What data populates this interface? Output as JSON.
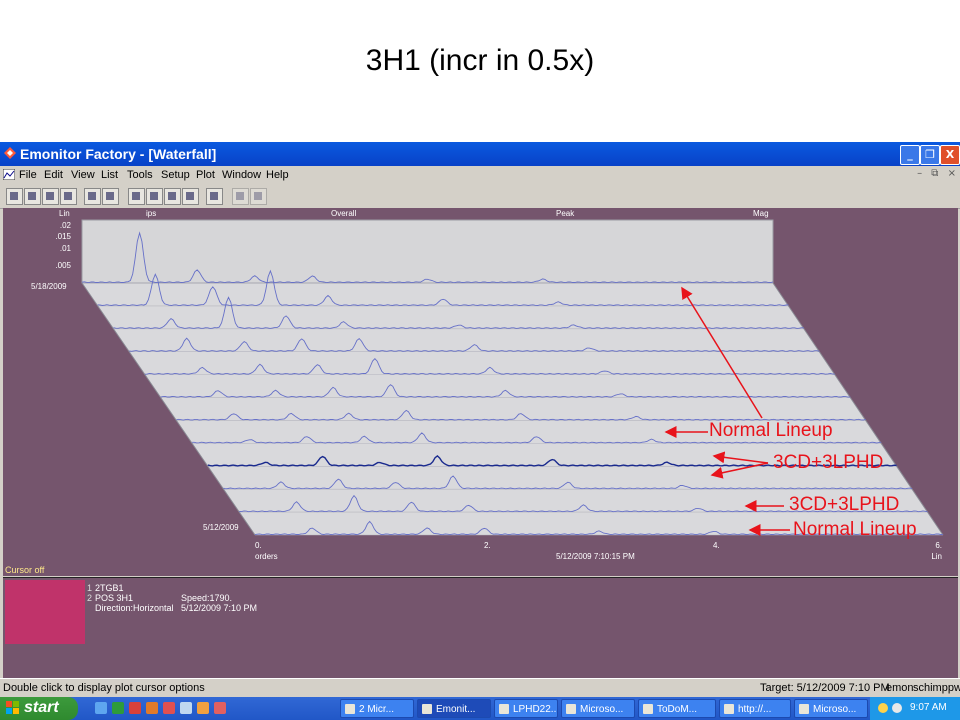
{
  "slide": {
    "title": "3H1 (incr in 0.5x)"
  },
  "window": {
    "title": "Emonitor Factory - [Waterfall]",
    "buttons": {
      "minimize": "_",
      "restore": "❐",
      "close": "X"
    },
    "mdi_buttons": [
      "–",
      "⧉",
      "×"
    ]
  },
  "menu": [
    "File",
    "Edit",
    "View",
    "List",
    "Tools",
    "Setup",
    "Plot",
    "Window",
    "Help"
  ],
  "plot": {
    "header": {
      "units": "Lin",
      "amplitude_unit": "ips",
      "overall": "Overall",
      "peak": "Peak",
      "mag": "Mag"
    },
    "y_ticks": [
      ".02",
      ".015",
      ".01",
      ".005"
    ],
    "date_top": "5/18/2009",
    "date_bottom": "5/12/2009",
    "x_ticks": [
      "0.",
      "2.",
      "4.",
      "6."
    ],
    "x_label": "orders",
    "x_scale": "Lin",
    "timestamp": "5/12/2009 7:10:15 PM",
    "cursor_status": "Cursor off"
  },
  "chart_data": {
    "type": "waterfall",
    "x_range": [
      0,
      6
    ],
    "x_unit": "orders",
    "y_range": [
      0,
      0.02
    ],
    "y_unit": "ips",
    "num_spectra": 12,
    "highlighted_spectrum": 8,
    "peak_orders": [
      0.5,
      1,
      1.5,
      2,
      3,
      4
    ]
  },
  "info": {
    "name": "2TGB1",
    "pos": "POS 3H1",
    "speed": "Speed:1790.",
    "direction": "Direction:Horizontal",
    "datetime": "5/12/2009 7:10 PM",
    "left_marks": [
      "1",
      "2"
    ]
  },
  "status": {
    "hint": "Double click to display plot cursor options",
    "target": "Target: 5/12/2009 7:10 PM",
    "panel1": "emon",
    "panel2": "schimppw"
  },
  "taskbar": {
    "start": "start",
    "items": [
      "2 Micr...",
      "Emonit...",
      "LPHD22...",
      "Microso...",
      "ToDoM...",
      "http://...",
      "Microso..."
    ],
    "time": "9:07 AM"
  },
  "annotations": {
    "normal_lineup_1": "Normal Lineup",
    "lphd_1": "3CD+3LPHD",
    "lphd_2": "3CD+3LPHD",
    "normal_lineup_2": "Normal Lineup"
  },
  "colors": {
    "plot_bg": "#75556d",
    "floor": "#d9d9dc",
    "trace": "#6670c8",
    "highlight": "#1a2a8e",
    "annotation": "#e8131b"
  }
}
